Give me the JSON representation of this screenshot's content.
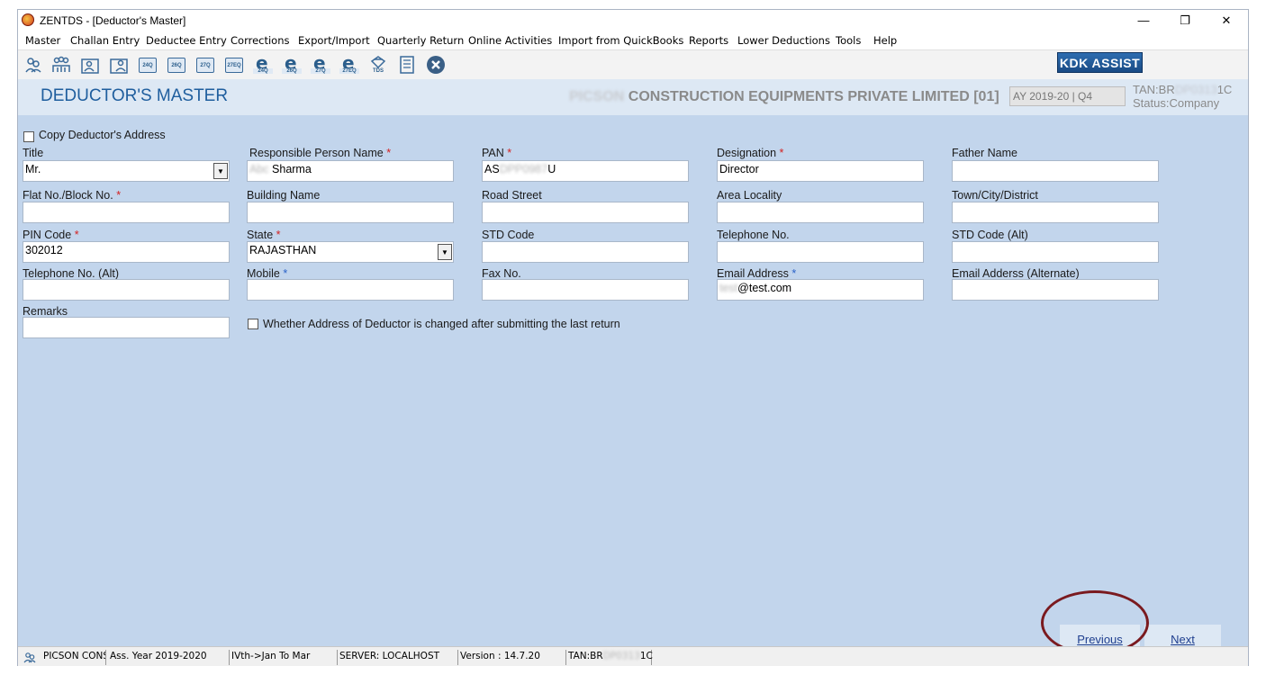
{
  "window": {
    "title": "ZENTDS - [Deductor's Master]",
    "controls": {
      "minimize": "—",
      "restore": "❐",
      "close": "✕"
    }
  },
  "menu": [
    "Master",
    "Challan Entry",
    "Deductee Entry",
    "Corrections",
    "Export/Import",
    "Quarterly Return",
    "Online Activities",
    "Import from QuickBooks",
    "Reports",
    "Lower Deductions",
    "Tools",
    "Help"
  ],
  "toolbar": {
    "icons": [
      "deductor-icon",
      "deductee-icon",
      "challan-icon",
      "challan-alt-icon",
      "form-24q-icon",
      "form-26q-icon",
      "form-27q-icon",
      "form-27eq-icon",
      "efile-24q-icon",
      "efile-26q-icon",
      "efile-27q-icon",
      "efile-27eq-icon",
      "tds-icon",
      "calculator-icon",
      "exit-icon"
    ],
    "icon_labels": {
      "f24q": "24Q",
      "f26q": "26Q",
      "f27q": "27Q",
      "f27eq": "27EQ",
      "e24q": "24Q",
      "e26q": "26Q",
      "e27q": "27Q",
      "e27eq": "27EQ",
      "tds": "TDS",
      "e_glyph": "e"
    },
    "kdk_assist": "KDK ASSIST"
  },
  "header": {
    "title": "DEDUCTOR'S MASTER",
    "company_blurred": "PICSON",
    "company": "CONSTRUCTION EQUIPMENTS PRIVATE LIMITED [01]",
    "ay_quarter": "AY 2019-20 | Q4",
    "tan_prefix": "TAN:BR",
    "tan_blurred": "DP0313",
    "tan_suffix": "1C",
    "status": "Status:Company"
  },
  "form": {
    "copy_address_label": "Copy Deductor's Address",
    "title": {
      "label": "Title",
      "value": "Mr."
    },
    "responsible_person": {
      "label": "Responsible Person Name",
      "value_blurred": "Abc",
      "value": "Sharma"
    },
    "pan": {
      "label": "PAN",
      "prefix": "AS",
      "blurred": "DPP0987",
      "suffix": "U"
    },
    "designation": {
      "label": "Designation",
      "value": "Director"
    },
    "father_name": {
      "label": "Father Name",
      "value": ""
    },
    "flat_no": {
      "label": "Flat No./Block No.",
      "value": ""
    },
    "building_name": {
      "label": "Building Name",
      "value": ""
    },
    "road_street": {
      "label": "Road Street",
      "value": ""
    },
    "area_locality": {
      "label": "Area Locality",
      "value": ""
    },
    "town_city": {
      "label": "Town/City/District",
      "value": ""
    },
    "pin_code": {
      "label": "PIN Code",
      "value": "302012"
    },
    "state": {
      "label": "State",
      "value": "RAJASTHAN"
    },
    "std_code": {
      "label": "STD Code",
      "value": ""
    },
    "telephone": {
      "label": "Telephone No.",
      "value": ""
    },
    "std_code_alt": {
      "label": "STD Code (Alt)",
      "value": ""
    },
    "telephone_alt": {
      "label": "Telephone No. (Alt)",
      "value": ""
    },
    "mobile": {
      "label": "Mobile",
      "value": ""
    },
    "fax": {
      "label": "Fax No.",
      "value": ""
    },
    "email": {
      "label": "Email Address",
      "blurred": "test",
      "value": "@test.com"
    },
    "email_alt": {
      "label": "Email Adderss (Alternate)",
      "value": ""
    },
    "remarks": {
      "label": "Remarks",
      "value": ""
    },
    "address_changed_label": "Whether Address of Deductor is changed after submitting the last return",
    "required_mark": "*",
    "dropdown_arrow": "▼"
  },
  "nav": {
    "previous": "Previous",
    "next": "Next"
  },
  "statusbar": {
    "company": "PICSON CONS",
    "assessment_year": "Ass. Year 2019-2020",
    "period": "IVth->Jan To Mar",
    "server": "SERVER: LOCALHOST",
    "version": "Version : 14.7.20",
    "tan_prefix": "TAN:BR",
    "tan_blurred": "DP0313",
    "tan_suffix": "1C"
  },
  "colors": {
    "content_bg": "#c2d5ec",
    "header_bg": "#dde8f4",
    "title_blue": "#1f5e9e",
    "required_red": "#d42020",
    "annotation_circle": "#7a1a1f"
  }
}
